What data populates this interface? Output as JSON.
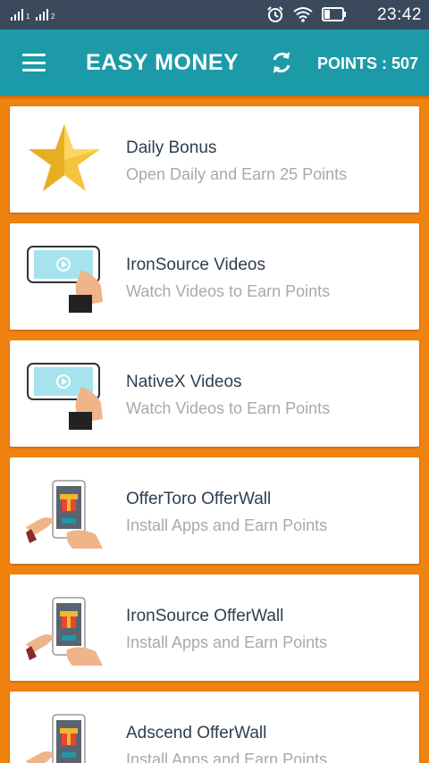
{
  "status_bar": {
    "time": "23:42"
  },
  "app_bar": {
    "title": "EASY MONEY",
    "points_label": "POINTS : 507"
  },
  "items": [
    {
      "title": "Daily Bonus",
      "subtitle": "Open Daily and Earn 25 Points",
      "icon": "star-icon"
    },
    {
      "title": "IronSource Videos",
      "subtitle": "Watch Videos to Earn Points",
      "icon": "video-phone-icon"
    },
    {
      "title": "NativeX Videos",
      "subtitle": "Watch Videos to Earn Points",
      "icon": "video-phone-icon"
    },
    {
      "title": "OfferToro OfferWall",
      "subtitle": "Install Apps and Earn Points",
      "icon": "gift-phone-icon"
    },
    {
      "title": "IronSource OfferWall",
      "subtitle": "Install Apps and Earn Points",
      "icon": "gift-phone-icon"
    },
    {
      "title": "Adscend OfferWall",
      "subtitle": "Install Apps and Earn Points",
      "icon": "gift-phone-icon"
    }
  ],
  "colors": {
    "status_bar": "#3a4a5c",
    "app_bar": "#1c9aa8",
    "background": "#f0820f",
    "title_text": "#2e3e4e",
    "subtitle_text": "#a9a9a9"
  }
}
